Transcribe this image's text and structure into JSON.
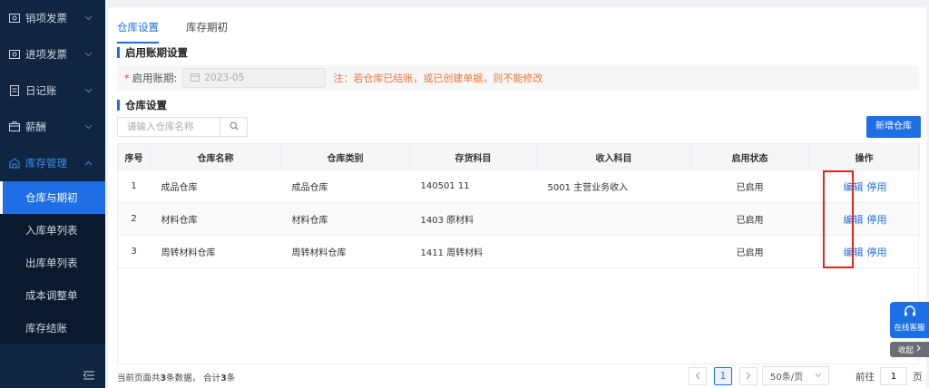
{
  "sidebar": {
    "items": [
      {
        "label": "销项发票",
        "icon": "invoice-icon"
      },
      {
        "label": "进项发票",
        "icon": "invoice-icon"
      },
      {
        "label": "日记账",
        "icon": "journal-icon"
      },
      {
        "label": "薪酬",
        "icon": "salary-icon"
      },
      {
        "label": "库存管理",
        "icon": "warehouse-icon"
      }
    ],
    "sub_items": [
      {
        "label": "仓库与期初"
      },
      {
        "label": "入库单列表"
      },
      {
        "label": "出库单列表"
      },
      {
        "label": "成本调整单"
      },
      {
        "label": "库存结账"
      }
    ]
  },
  "tabs": [
    {
      "label": "仓库设置"
    },
    {
      "label": "库存期初"
    }
  ],
  "period_section": {
    "title": "启用账期设置",
    "required_mark": "*",
    "label": "启用账期:",
    "value": "2023-05",
    "note": "注：若仓库已结账，或已创建单据，则不能修改"
  },
  "warehouse_section": {
    "title": "仓库设置",
    "search_placeholder": "请输入仓库名称",
    "new_button": "新增仓库"
  },
  "table": {
    "headers": [
      "序号",
      "仓库名称",
      "仓库类别",
      "存货科目",
      "收入科目",
      "启用状态",
      "操作"
    ],
    "rows": [
      {
        "index": "1",
        "name": "成品仓库",
        "category": "成品仓库",
        "inventory_account": "140501 11",
        "income_account": "5001 主营业务收入",
        "status": "已启用",
        "edit": "编辑",
        "disable": "停用"
      },
      {
        "index": "2",
        "name": "材料仓库",
        "category": "材料仓库",
        "inventory_account": "1403 原材料",
        "income_account": "",
        "status": "已启用",
        "edit": "编辑",
        "disable": "停用"
      },
      {
        "index": "3",
        "name": "周转材料仓库",
        "category": "周转材料仓库",
        "inventory_account": "1411 周转材料",
        "income_account": "",
        "status": "已启用",
        "edit": "编辑",
        "disable": "停用"
      }
    ]
  },
  "footer": {
    "summary_prefix": "当前页面共",
    "summary_count": "3",
    "summary_mid": "条数据，  合计",
    "summary_total": "3",
    "summary_suffix": "条",
    "current_page": "1",
    "page_size": "50条/页",
    "goto_prefix": "前往",
    "goto_value": "1",
    "goto_suffix": "页"
  },
  "widgets": {
    "customer_service": "在线客服",
    "collapse": "收起"
  },
  "colors": {
    "primary": "#1e6fe6",
    "sidebar_bg": "#0f2540",
    "note": "#f0763a",
    "highlight": "#e0251e"
  }
}
